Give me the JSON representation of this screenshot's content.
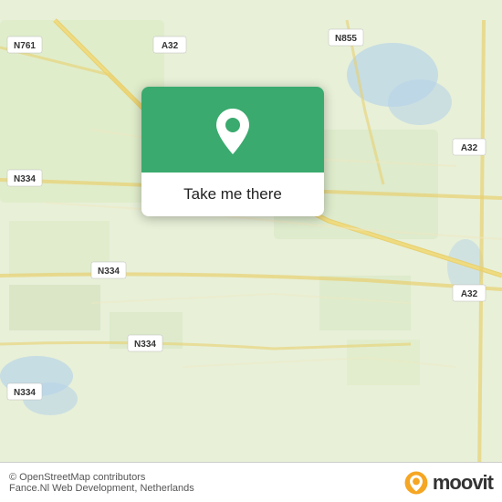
{
  "map": {
    "background_color": "#e8f0d8",
    "center_lat": 52.85,
    "center_lon": 5.85
  },
  "popup": {
    "background_color": "#3aaa6e",
    "button_label": "Take me there",
    "pin_color": "#ffffff"
  },
  "footer": {
    "copyright_text": "© OpenStreetMap contributors",
    "brand_name": "Fance.Nl Web Development, Netherlands",
    "moovit_label": "moovit"
  },
  "road_labels": {
    "n761": "N761",
    "a32_top": "A32",
    "n855": "N855",
    "n334_left": "N334",
    "n334_mid": "N334",
    "n334_lower": "N334",
    "n334_bottom": "N334",
    "a32_right": "A32",
    "a32_far_right": "A32",
    "n334_road": "N334"
  }
}
